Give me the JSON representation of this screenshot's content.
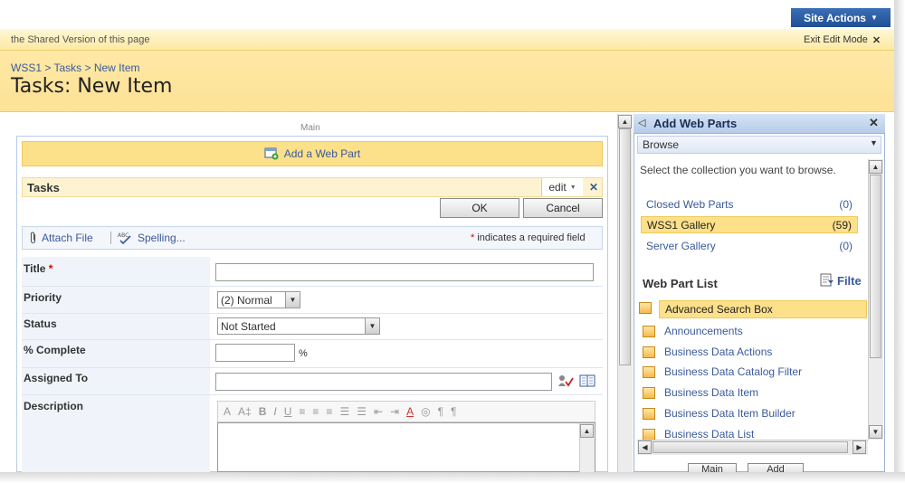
{
  "topbar": {
    "site_actions": "Site Actions",
    "site_actions_arrow": "▼"
  },
  "editbar": {
    "text": "the Shared Version of this page",
    "exit_label": "Exit Edit Mode",
    "exit_close": "✕"
  },
  "title_area": {
    "breadcrumb": "WSS1 > Tasks > New Item",
    "title": "Tasks: New Item"
  },
  "zone": {
    "label": "Main",
    "add_web_part": "Add a Web Part"
  },
  "web_part": {
    "title": "Tasks",
    "edit_label": "edit",
    "edit_arrow": "▼",
    "close": "✕",
    "ok": "OK",
    "cancel": "Cancel",
    "toolbar": {
      "attach_file": "Attach File",
      "spelling": "Spelling...",
      "required_star": "*",
      "required_note": " indicates a required field"
    },
    "fields": {
      "title_label": "Title",
      "title_star": "*",
      "priority_label": "Priority",
      "priority_value": "(2) Normal",
      "status_label": "Status",
      "status_value": "Not Started",
      "complete_label": "% Complete",
      "complete_unit": "%",
      "assigned_label": "Assigned To",
      "description_label": "Description"
    },
    "rte_tools": [
      "A",
      "A‡",
      "B",
      "I",
      "U",
      "≡",
      "≡",
      "≡",
      "☰",
      "☰",
      "⇤",
      "⇥",
      "A",
      "◎",
      "¶",
      "¶"
    ]
  },
  "tool_pane": {
    "back_arrow": "◁",
    "title": "Add Web Parts",
    "close": "✕",
    "browse": "Browse",
    "browse_arrow": "▼",
    "description": "Select the collection you want to browse.",
    "galleries": [
      {
        "name": "Closed Web Parts",
        "count": "(0)"
      },
      {
        "name": "WSS1 Gallery",
        "count": "(59)"
      },
      {
        "name": "Server Gallery",
        "count": "(0)"
      }
    ],
    "list_title": "Web Part List",
    "filter": "Filte",
    "web_parts": [
      "Advanced Search Box",
      "Announcements",
      "Business Data Actions",
      "Business Data Catalog Filter",
      "Business Data Item",
      "Business Data Item Builder",
      "Business Data List"
    ],
    "bottom_left": "Main",
    "bottom_right": "Add"
  },
  "colors": {
    "accent_blue": "#1f4f95",
    "highlight_yellow": "#fde08a",
    "link": "#3a5a9a"
  }
}
